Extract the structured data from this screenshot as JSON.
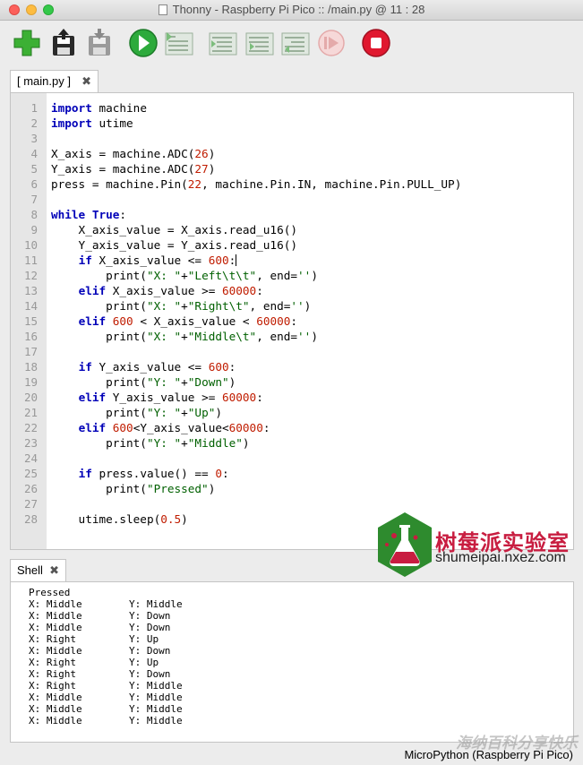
{
  "window": {
    "title": "Thonny  -  Raspberry Pi Pico :: /main.py  @  11 : 28"
  },
  "toolbar": {
    "buttons": [
      {
        "name": "new-file",
        "icon": "green-plus-icon"
      },
      {
        "name": "open-file",
        "icon": "floppy-open-icon"
      },
      {
        "name": "save-file",
        "icon": "floppy-save-icon"
      },
      {
        "name": "run",
        "icon": "green-play-icon"
      },
      {
        "name": "debug",
        "icon": "debug-icon"
      },
      {
        "name": "step-over",
        "icon": "step-over-icon"
      },
      {
        "name": "step-into",
        "icon": "step-into-icon"
      },
      {
        "name": "step-out",
        "icon": "step-out-icon"
      },
      {
        "name": "resume",
        "icon": "resume-icon"
      },
      {
        "name": "stop",
        "icon": "red-stop-icon"
      }
    ]
  },
  "editor": {
    "tab_label": "[ main.py ]",
    "close_glyph": "✖",
    "line_numbers": [
      "1",
      "2",
      "3",
      "4",
      "5",
      "6",
      "7",
      "8",
      "9",
      "10",
      "11",
      "12",
      "13",
      "14",
      "15",
      "16",
      "17",
      "18",
      "19",
      "20",
      "21",
      "22",
      "23",
      "24",
      "25",
      "26",
      "27",
      "28"
    ],
    "lines": [
      [
        {
          "t": "import",
          "c": "kw"
        },
        {
          "t": " machine",
          "c": ""
        }
      ],
      [
        {
          "t": "import",
          "c": "kw"
        },
        {
          "t": " utime",
          "c": ""
        }
      ],
      [],
      [
        {
          "t": "X_axis = machine.ADC(",
          "c": ""
        },
        {
          "t": "26",
          "c": "num"
        },
        {
          "t": ")",
          "c": ""
        }
      ],
      [
        {
          "t": "Y_axis = machine.ADC(",
          "c": ""
        },
        {
          "t": "27",
          "c": "num"
        },
        {
          "t": ")",
          "c": ""
        }
      ],
      [
        {
          "t": "press = machine.Pin(",
          "c": ""
        },
        {
          "t": "22",
          "c": "num"
        },
        {
          "t": ", machine.Pin.IN, machine.Pin.PULL_UP)",
          "c": ""
        }
      ],
      [],
      [
        {
          "t": "while",
          "c": "kw"
        },
        {
          "t": " ",
          "c": ""
        },
        {
          "t": "True",
          "c": "kw"
        },
        {
          "t": ":",
          "c": ""
        }
      ],
      [
        {
          "t": "    X_axis_value = X_axis.read_u16()",
          "c": ""
        }
      ],
      [
        {
          "t": "    Y_axis_value = Y_axis.read_u16()",
          "c": ""
        }
      ],
      [
        {
          "t": "    ",
          "c": ""
        },
        {
          "t": "if",
          "c": "kw"
        },
        {
          "t": " X_axis_value <= ",
          "c": ""
        },
        {
          "t": "600",
          "c": "num"
        },
        {
          "t": ":",
          "c": ""
        },
        {
          "t": "",
          "c": "caret"
        }
      ],
      [
        {
          "t": "        print(",
          "c": ""
        },
        {
          "t": "\"X: \"",
          "c": "str"
        },
        {
          "t": "+",
          "c": ""
        },
        {
          "t": "\"Left\\t\\t\"",
          "c": "str"
        },
        {
          "t": ", end=",
          "c": ""
        },
        {
          "t": "''",
          "c": "str"
        },
        {
          "t": ")",
          "c": ""
        }
      ],
      [
        {
          "t": "    ",
          "c": ""
        },
        {
          "t": "elif",
          "c": "kw"
        },
        {
          "t": " X_axis_value >= ",
          "c": ""
        },
        {
          "t": "60000",
          "c": "num"
        },
        {
          "t": ":",
          "c": ""
        }
      ],
      [
        {
          "t": "        print(",
          "c": ""
        },
        {
          "t": "\"X: \"",
          "c": "str"
        },
        {
          "t": "+",
          "c": ""
        },
        {
          "t": "\"Right\\t\"",
          "c": "str"
        },
        {
          "t": ", end=",
          "c": ""
        },
        {
          "t": "''",
          "c": "str"
        },
        {
          "t": ")",
          "c": ""
        }
      ],
      [
        {
          "t": "    ",
          "c": ""
        },
        {
          "t": "elif",
          "c": "kw"
        },
        {
          "t": " ",
          "c": ""
        },
        {
          "t": "600",
          "c": "num"
        },
        {
          "t": " < X_axis_value < ",
          "c": ""
        },
        {
          "t": "60000",
          "c": "num"
        },
        {
          "t": ":",
          "c": ""
        }
      ],
      [
        {
          "t": "        print(",
          "c": ""
        },
        {
          "t": "\"X: \"",
          "c": "str"
        },
        {
          "t": "+",
          "c": ""
        },
        {
          "t": "\"Middle\\t\"",
          "c": "str"
        },
        {
          "t": ", end=",
          "c": ""
        },
        {
          "t": "''",
          "c": "str"
        },
        {
          "t": ")",
          "c": ""
        }
      ],
      [],
      [
        {
          "t": "    ",
          "c": ""
        },
        {
          "t": "if",
          "c": "kw"
        },
        {
          "t": " Y_axis_value <= ",
          "c": ""
        },
        {
          "t": "600",
          "c": "num"
        },
        {
          "t": ":",
          "c": ""
        }
      ],
      [
        {
          "t": "        print(",
          "c": ""
        },
        {
          "t": "\"Y: \"",
          "c": "str"
        },
        {
          "t": "+",
          "c": ""
        },
        {
          "t": "\"Down\"",
          "c": "str"
        },
        {
          "t": ")",
          "c": ""
        }
      ],
      [
        {
          "t": "    ",
          "c": ""
        },
        {
          "t": "elif",
          "c": "kw"
        },
        {
          "t": " Y_axis_value >= ",
          "c": ""
        },
        {
          "t": "60000",
          "c": "num"
        },
        {
          "t": ":",
          "c": ""
        }
      ],
      [
        {
          "t": "        print(",
          "c": ""
        },
        {
          "t": "\"Y: \"",
          "c": "str"
        },
        {
          "t": "+",
          "c": ""
        },
        {
          "t": "\"Up\"",
          "c": "str"
        },
        {
          "t": ")",
          "c": ""
        }
      ],
      [
        {
          "t": "    ",
          "c": ""
        },
        {
          "t": "elif",
          "c": "kw"
        },
        {
          "t": " ",
          "c": ""
        },
        {
          "t": "600",
          "c": "num"
        },
        {
          "t": "<Y_axis_value<",
          "c": ""
        },
        {
          "t": "60000",
          "c": "num"
        },
        {
          "t": ":",
          "c": ""
        }
      ],
      [
        {
          "t": "        print(",
          "c": ""
        },
        {
          "t": "\"Y: \"",
          "c": "str"
        },
        {
          "t": "+",
          "c": ""
        },
        {
          "t": "\"Middle\"",
          "c": "str"
        },
        {
          "t": ")",
          "c": ""
        }
      ],
      [],
      [
        {
          "t": "    ",
          "c": ""
        },
        {
          "t": "if",
          "c": "kw"
        },
        {
          "t": " press.value() == ",
          "c": ""
        },
        {
          "t": "0",
          "c": "num"
        },
        {
          "t": ":",
          "c": ""
        }
      ],
      [
        {
          "t": "        print(",
          "c": ""
        },
        {
          "t": "\"Pressed\"",
          "c": "str"
        },
        {
          "t": ")",
          "c": ""
        }
      ],
      [],
      [
        {
          "t": "    utime.sleep(",
          "c": ""
        },
        {
          "t": "0.5",
          "c": "num"
        },
        {
          "t": ")",
          "c": ""
        }
      ]
    ]
  },
  "logo": {
    "name_cn": "树莓派实验室",
    "url": "shumeipai.nxez.com"
  },
  "shell": {
    "tab_label": "Shell",
    "close_glyph": "✖",
    "first_line": "Pressed",
    "rows": [
      [
        "X: Middle",
        "Y: Middle"
      ],
      [
        "X: Middle",
        "Y: Down"
      ],
      [
        "X: Middle",
        "Y: Down"
      ],
      [
        "X: Right",
        "Y: Up"
      ],
      [
        "X: Middle",
        "Y: Down"
      ],
      [
        "X: Right",
        "Y: Up"
      ],
      [
        "X: Right",
        "Y: Down"
      ],
      [
        "X: Right",
        "Y: Middle"
      ],
      [
        "X: Middle",
        "Y: Middle"
      ],
      [
        "X: Middle",
        "Y: Middle"
      ],
      [
        "X: Middle",
        "Y: Middle"
      ]
    ]
  },
  "status": {
    "interpreter": "MicroPython (Raspberry Pi Pico)"
  },
  "watermark": {
    "text": "海纳百科分享快乐"
  },
  "colors": {
    "keyword": "#0000b8",
    "number": "#c01c00",
    "string": "#006000",
    "logo_red": "#c81d40",
    "logo_green": "#2e8b2e"
  }
}
